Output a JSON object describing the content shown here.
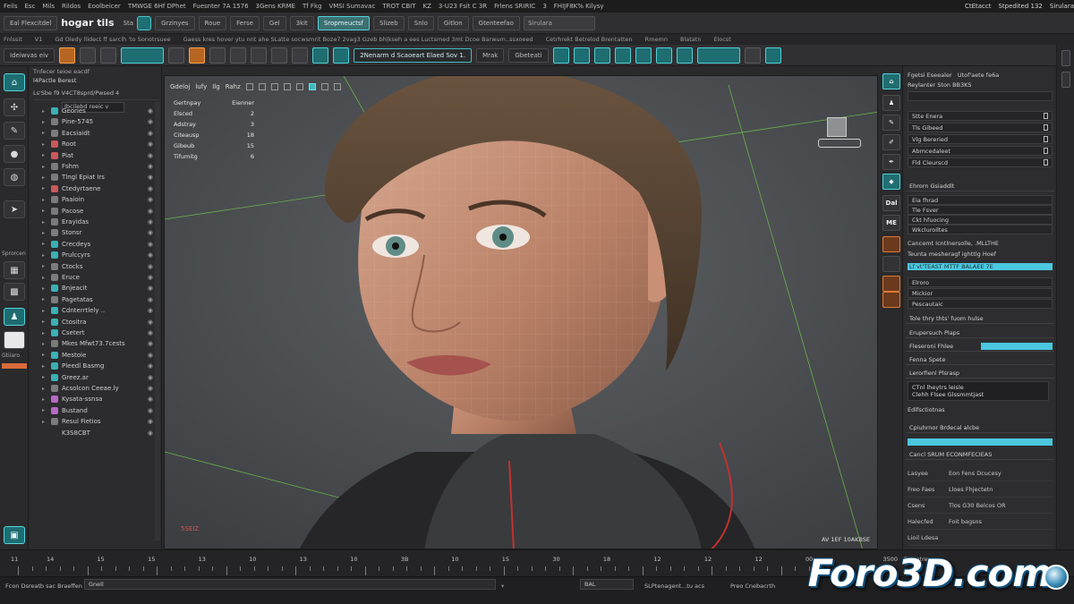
{
  "menubar": {
    "items": [
      "Feils",
      "Esc",
      "Mils",
      "Rildos",
      "Eoolbeicer",
      "TMWGE 6Hf DPhet",
      "Fuesnter 7A 1576",
      "3Gens KRME",
      "Tf Fkg",
      "VMSI Sumavac",
      "TROT CBIT",
      "KZ",
      "3-U23 Fsit C 3R",
      "Frlens SRIRIC",
      "3",
      "FHIJF8K% Kilysy"
    ],
    "right": [
      "CtEtacct",
      "Stpedited 132",
      "Sirulara"
    ]
  },
  "toolbar1": {
    "menu_label": "Eal Flexcitdel",
    "brand": "hogar tils",
    "brand_suffix": "Sta",
    "tabs": [
      "Grzinyes",
      "Roue",
      "Ferse",
      "Gel",
      "3kit",
      "Sropmeuctsf",
      "Slizeb",
      "Snlo",
      "Gitlon",
      "Gtenteefao"
    ],
    "active_tab_index": 5,
    "search_placeholder": "Sirulara",
    "accent": "#45c9cf"
  },
  "subbar": {
    "items": [
      "Fnlssit",
      "V1",
      "Gd Oledy llidect ff sarclh 'to Sonotrsuee",
      "Gaess kres hover ytu nnt ahe SLatte socwsmrit Boze7 2vag3 Gzeb bh|kseh a ees Luctsmed 3mt Dcoe Barwum..ssxoeed",
      "Cetrhrekt Betrelod Brentatten",
      "Rmemn",
      "Blatatn",
      "Elocst"
    ]
  },
  "toolbar2": {
    "label1": "Ideiwvas eiv",
    "label2": "2Nenarm d Scaoeart Elaed Sov 1.",
    "label3": "Mrak",
    "label4": "Gbeteati",
    "accent_orange": "#d86a3a"
  },
  "leftstrip": {
    "label1": "Sprorcen",
    "label2": "Gtiiaro"
  },
  "outliner": {
    "header": "Tnfecer teioe eacdf",
    "title": "l4Pactle Berest",
    "subtitle": "Ls'Sbe f9 V4CT8sprd/Pwsed 4",
    "filter": "Ibcilebd reeic v",
    "items": [
      {
        "label": "Geories",
        "icon": "teal"
      },
      {
        "label": "Pine-5745",
        "icon": "grey"
      },
      {
        "label": "Eacsiaidt",
        "icon": "grey"
      },
      {
        "label": "Root",
        "icon": "red"
      },
      {
        "label": "Piat",
        "icon": "red"
      },
      {
        "label": "Fshm",
        "icon": "grey"
      },
      {
        "label": "Tlngl Epiat Irs",
        "icon": "grey"
      },
      {
        "label": "Ctedyrtaene",
        "icon": "red"
      },
      {
        "label": "Paaioin",
        "icon": "grey"
      },
      {
        "label": "Pacose",
        "icon": "grey"
      },
      {
        "label": "Erayidas",
        "icon": "grey"
      },
      {
        "label": "Stonsr",
        "icon": "grey"
      },
      {
        "label": "Crecdeys",
        "icon": "teal"
      },
      {
        "label": "Prulccyrs",
        "icon": "teal"
      },
      {
        "label": "Ctocks",
        "icon": "grey"
      },
      {
        "label": "Eruce",
        "icon": "grey"
      },
      {
        "label": "Bnjeacit",
        "icon": "teal"
      },
      {
        "label": "Pagetatas",
        "icon": "grey"
      },
      {
        "label": "Cdnterrtlely ..",
        "icon": "teal"
      },
      {
        "label": "Ctositra",
        "icon": "teal"
      },
      {
        "label": "Csetert",
        "icon": "teal"
      },
      {
        "label": "Mkes Mfwt73.7cests",
        "icon": "grey"
      },
      {
        "label": "Mestoie",
        "icon": "teal"
      },
      {
        "label": "Pleedl Basmg",
        "icon": "teal"
      },
      {
        "label": "Greez.ar",
        "icon": "teal"
      },
      {
        "label": "Acsolcon Ceeae.ly",
        "icon": "grey"
      },
      {
        "label": "Kysata-ssnsa",
        "icon": "purple"
      },
      {
        "label": "Bustand",
        "icon": "purple"
      },
      {
        "label": "Resul Fietios",
        "icon": "grey"
      },
      {
        "label": "K3S8CBT",
        "icon": "none"
      }
    ]
  },
  "viewport": {
    "toolbar": [
      "Gdeloj",
      "lufy",
      "Ilg",
      "Rahz"
    ],
    "stats_header": "Gertnpay",
    "stats_header2": "Eienner",
    "stats": [
      {
        "k": "Elsced",
        "v": "2"
      },
      {
        "k": "Adstray",
        "v": "3"
      },
      {
        "k": "Citeausp",
        "v": "18"
      },
      {
        "k": "Gibeub",
        "v": "15"
      },
      {
        "k": "Tifumitg",
        "v": "6"
      }
    ],
    "axis_label": "5SEIZ",
    "corner_label": "AV 1EF 10AKBSE"
  },
  "rightstrip": {
    "labels": [
      "Dal",
      "ME"
    ]
  },
  "properties": {
    "header1": "Fgetsi Eseealer",
    "header1b": "Utof'aete fe6a",
    "header2": "Reylanter Ston BB3KS",
    "group1": [
      "Stte Enera",
      "Tls Gibeed",
      "Vlg Bereried",
      "Abmcedaleet",
      "Fld Cleurscd"
    ],
    "section2": "Ehrorn Gsiaddlt",
    "group2": [
      "Eia fhrad",
      "Tle Fsver",
      "Ckt hfuocing",
      "Wkcluroiltes"
    ],
    "text3": "Cancemt Icntlnersolle, .MLLTHE",
    "text4": "Teunta mesheragf ighttlg Hoef",
    "bar1_label": "Lf vt'TEAST MTTF BALAEE 7E",
    "group5": [
      "Elroro",
      "Mickior",
      "Pescautaic"
    ],
    "text6": "Tole thry thts' fuom hulse",
    "text7": "Erupersuch Plaps",
    "text8": "Fleseroni Fhlee",
    "text9": "Fenna Spete",
    "section10": "Lerorfienl Plsrasp",
    "dark_line1": "CTnl lheytrs leisle",
    "dark_line2": "Clehh Flsee Glssmmtjast",
    "text11": "Edlfsctiotnas",
    "text12": "Cpiuhrnor Brdecal alcbe",
    "text13": "Cancl SRUM ECONMFECIEAS",
    "kv": [
      {
        "k": "Lasyee",
        "v": "Eon Fens Dcucesy"
      },
      {
        "k": "Freo Faes",
        "v": "Lloes Fhjectetn"
      },
      {
        "k": "Csens",
        "v": "Tlos G30 Belcos OR"
      },
      {
        "k": "Halecfed",
        "v": "Foit bagsns"
      },
      {
        "k": "Lioil Ldesa",
        "v": ""
      }
    ],
    "accent_bar": "#4bc7e0"
  },
  "timeline": {
    "left_label": "11",
    "numbers": [
      "14",
      "15",
      "15",
      "13",
      "10",
      "13",
      "10",
      "3B",
      "10",
      "15",
      "30",
      "18",
      "12",
      "12",
      "12",
      "00"
    ],
    "right_labels": [
      "3500",
      "Gtrnetres"
    ]
  },
  "statusbar": {
    "left": "Fcon Dsreatb sac Braeffen",
    "field1": "Gnell",
    "field2": "BAL",
    "field3": "SLPtenagent...tu acs",
    "field4": "Preo Cnebacrth"
  },
  "watermark": {
    "text": "Foro3D.com"
  }
}
